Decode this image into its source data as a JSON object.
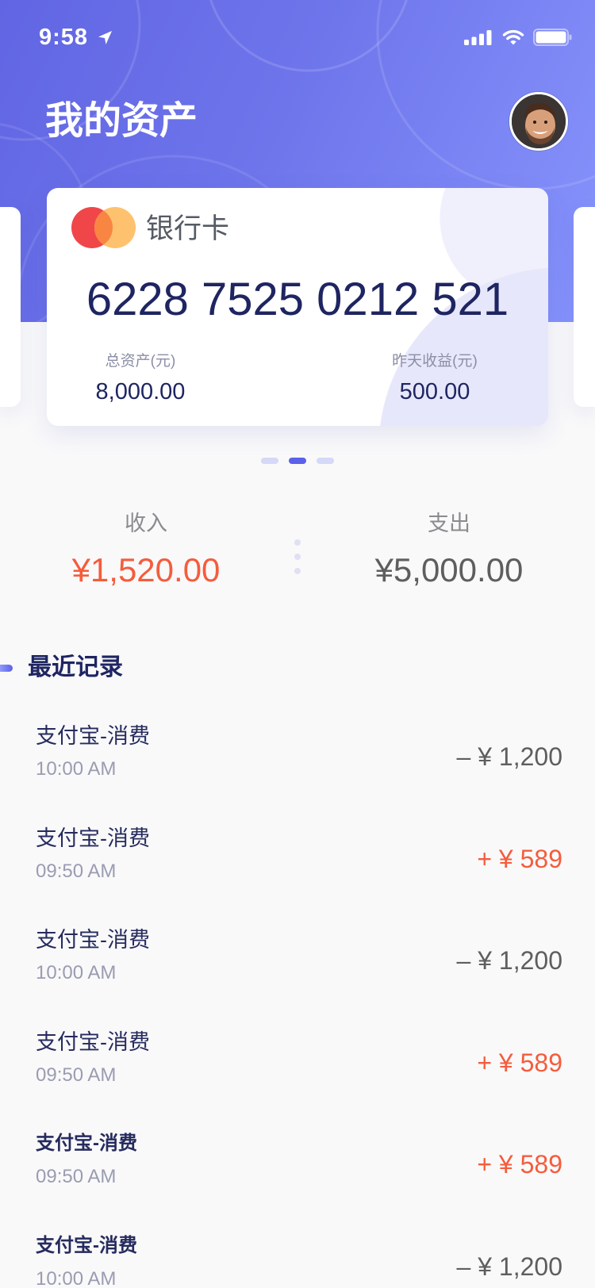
{
  "status_bar": {
    "time": "9:58",
    "icons": [
      "location-arrow-icon",
      "cellular-signal-icon",
      "wifi-icon",
      "battery-icon"
    ]
  },
  "header": {
    "title": "我的资产",
    "avatar_icon": "user-avatar"
  },
  "card": {
    "logo_icon": "mastercard-logo",
    "type_label": "银行卡",
    "number": "6228 7525 0212 521",
    "stats": [
      {
        "label": "总资产(元)",
        "value": "8,000.00"
      },
      {
        "label": "昨天收益(元)",
        "value": "500.00"
      }
    ]
  },
  "carousel": {
    "page_count": 3,
    "active_page": 2
  },
  "summary": {
    "income": {
      "label": "收入",
      "value": "¥1,520.00"
    },
    "expense": {
      "label": "支出",
      "value": "¥5,000.00"
    }
  },
  "records": {
    "title": "最近记录",
    "items": [
      {
        "title": "支付宝-消费",
        "time": "10:00 AM",
        "amount": "– ¥ 1,200",
        "amount_color": "#5e5e5e"
      },
      {
        "title": "支付宝-消费",
        "time": "09:50 AM",
        "amount": "+ ¥ 589",
        "amount_color": "#f55c3c"
      },
      {
        "title": "支付宝-消费",
        "time": "10:00 AM",
        "amount": "– ¥ 1,200",
        "amount_color": "#5e5e5e"
      },
      {
        "title": "支付宝-消费",
        "time": "09:50 AM",
        "amount": "+ ¥ 589",
        "amount_color": "#f55c3c"
      },
      {
        "title": "支付宝-消费",
        "time": "09:50 AM",
        "amount": "+ ¥ 589",
        "amount_color": "#f55c3c"
      },
      {
        "title": "支付宝-消费",
        "time": "10:00 AM",
        "amount": "– ¥ 1,200",
        "amount_color": "#5e5e5e"
      }
    ]
  },
  "colors": {
    "header_gradient_start": "#6165e3",
    "header_gradient_end": "#8794fc",
    "accent": "#5b61e9",
    "primary_text": "#1e2561",
    "income": "#f55c3c",
    "expense": "#5e5e5e"
  }
}
